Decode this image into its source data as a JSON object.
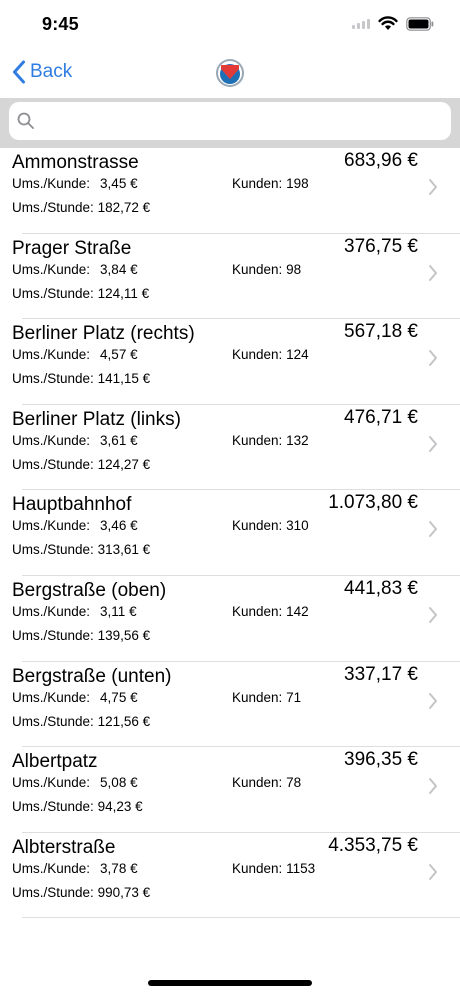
{
  "status": {
    "time": "9:45"
  },
  "nav": {
    "back_label": "Back",
    "logo_icon": "app-logo"
  },
  "search": {
    "placeholder": ""
  },
  "labels": {
    "per_customer": "Ums./Kunde:",
    "per_hour": "Ums./Stunde:",
    "customers": "Kunden:"
  },
  "locations": [
    {
      "name": "Ammonstrasse",
      "total": "683,96 €",
      "per_customer": "3,45 €",
      "customers": "198",
      "per_hour": "182,72 €"
    },
    {
      "name": "Prager Straße",
      "total": "376,75 €",
      "per_customer": "3,84 €",
      "customers": "98",
      "per_hour": "124,11 €"
    },
    {
      "name": "Berliner Platz (rechts)",
      "total": "567,18 €",
      "per_customer": "4,57 €",
      "customers": "124",
      "per_hour": "141,15 €"
    },
    {
      "name": "Berliner Platz (links)",
      "total": "476,71 €",
      "per_customer": "3,61 €",
      "customers": "132",
      "per_hour": "124,27 €"
    },
    {
      "name": "Hauptbahnhof",
      "total": "1.073,80 €",
      "per_customer": "3,46 €",
      "customers": "310",
      "per_hour": "313,61 €"
    },
    {
      "name": "Bergstraße (oben)",
      "total": "441,83 €",
      "per_customer": "3,11 €",
      "customers": "142",
      "per_hour": "139,56 €"
    },
    {
      "name": "Bergstraße (unten)",
      "total": "337,17 €",
      "per_customer": "4,75 €",
      "customers": "71",
      "per_hour": "121,56 €"
    },
    {
      "name": "Albertpatz",
      "total": "396,35 €",
      "per_customer": "5,08 €",
      "customers": "78",
      "per_hour": "94,23 €"
    },
    {
      "name": "Albterstraße",
      "total": "4.353,75 €",
      "per_customer": "3,78 €",
      "customers": "1153",
      "per_hour": "990,73 €"
    }
  ]
}
